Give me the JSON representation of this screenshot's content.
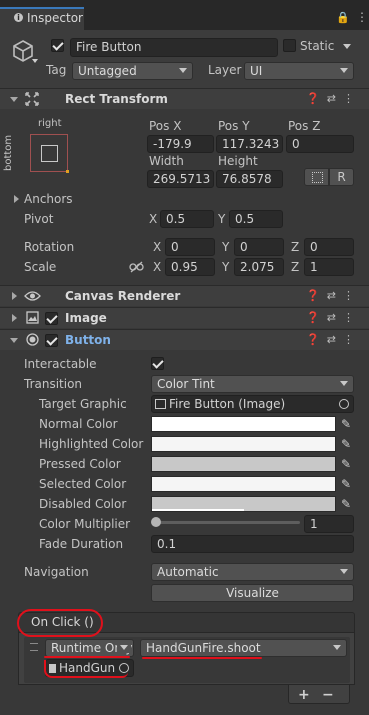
{
  "tab": {
    "title": "Inspector"
  },
  "gameobject": {
    "name": "Fire Button",
    "static_label": "Static",
    "tag_label": "Tag",
    "tag_value": "Untagged",
    "layer_label": "Layer",
    "layer_value": "UI"
  },
  "rect_transform": {
    "title": "Rect Transform",
    "anchor_preset_top": "right",
    "anchor_preset_side": "bottom",
    "posx_label": "Pos X",
    "posx": "-179.9",
    "posy_label": "Pos Y",
    "posy": "117.3243",
    "posz_label": "Pos Z",
    "posz": "0",
    "width_label": "Width",
    "width": "269.5713",
    "height_label": "Height",
    "height": "76.8578",
    "r_button": "R",
    "anchors_label": "Anchors",
    "pivot_label": "Pivot",
    "pivot_x": "0.5",
    "pivot_y": "0.5",
    "rotation_label": "Rotation",
    "rot_x": "0",
    "rot_y": "0",
    "rot_z": "0",
    "scale_label": "Scale",
    "scale_x": "0.95",
    "scale_y": "2.075",
    "scale_z": "1",
    "x": "X",
    "y": "Y",
    "z": "Z"
  },
  "canvas_renderer": {
    "title": "Canvas Renderer"
  },
  "image": {
    "title": "Image"
  },
  "button": {
    "title": "Button",
    "interactable_label": "Interactable",
    "transition_label": "Transition",
    "transition_value": "Color Tint",
    "target_graphic_label": "Target Graphic",
    "target_graphic_value": "Fire Button (Image)",
    "normal_color_label": "Normal Color",
    "highlighted_color_label": "Highlighted Color",
    "pressed_color_label": "Pressed Color",
    "selected_color_label": "Selected Color",
    "disabled_color_label": "Disabled Color",
    "color_multiplier_label": "Color Multiplier",
    "color_multiplier_value": "1",
    "fade_duration_label": "Fade Duration",
    "fade_duration_value": "0.1",
    "navigation_label": "Navigation",
    "navigation_value": "Automatic",
    "visualize_label": "Visualize",
    "colors": {
      "normal": "#ffffff",
      "highlighted": "#f5f5f5",
      "pressed": "#c8c8c8",
      "selected": "#f5f5f5",
      "disabled": "#c8c8c8"
    }
  },
  "onclick": {
    "header": "On Click ()",
    "runtime": "Runtime Only",
    "function": "HandGunFire.shoot",
    "object": "HandGun",
    "plus": "+",
    "minus": "−"
  }
}
